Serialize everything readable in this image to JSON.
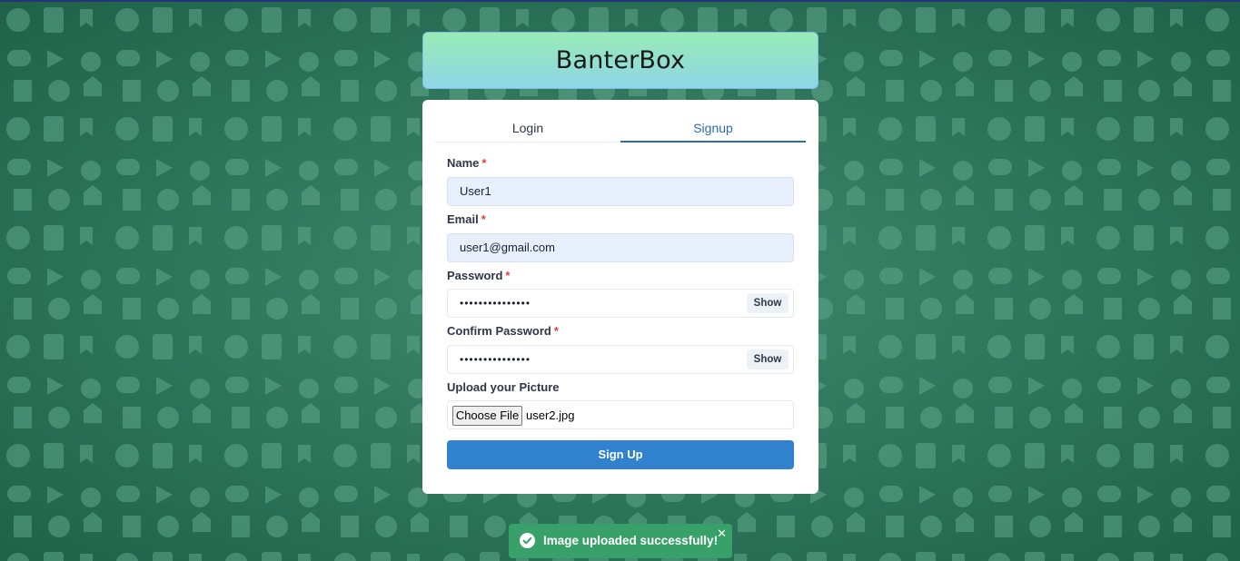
{
  "app": {
    "title": "BanterBox"
  },
  "tabs": [
    {
      "label": "Login",
      "active": false
    },
    {
      "label": "Signup",
      "active": true
    }
  ],
  "form": {
    "name": {
      "label": "Name",
      "required_mark": "*",
      "value": "User1"
    },
    "email": {
      "label": "Email",
      "required_mark": "*",
      "value": "user1@gmail.com"
    },
    "password": {
      "label": "Password",
      "required_mark": "*",
      "masked_value": "•••••••••••••••",
      "show_label": "Show"
    },
    "confirm_password": {
      "label": "Confirm Password",
      "required_mark": "*",
      "masked_value": "•••••••••••••••",
      "show_label": "Show"
    },
    "picture": {
      "label": "Upload your Picture",
      "button_label": "Choose File",
      "file_name": "user2.jpg"
    },
    "submit_label": "Sign Up"
  },
  "toast": {
    "message": "Image uploaded successfully!",
    "close_glyph": "✕",
    "status": "success"
  },
  "colors": {
    "background": "#2f7a5e",
    "accent": "#3182ce",
    "tab_active": "#2b6cb0",
    "toast_success": "#38a169",
    "required": "#e53e3e",
    "header_gradient_top": "#98ebb6",
    "header_gradient_bottom": "#8fd6e6"
  }
}
